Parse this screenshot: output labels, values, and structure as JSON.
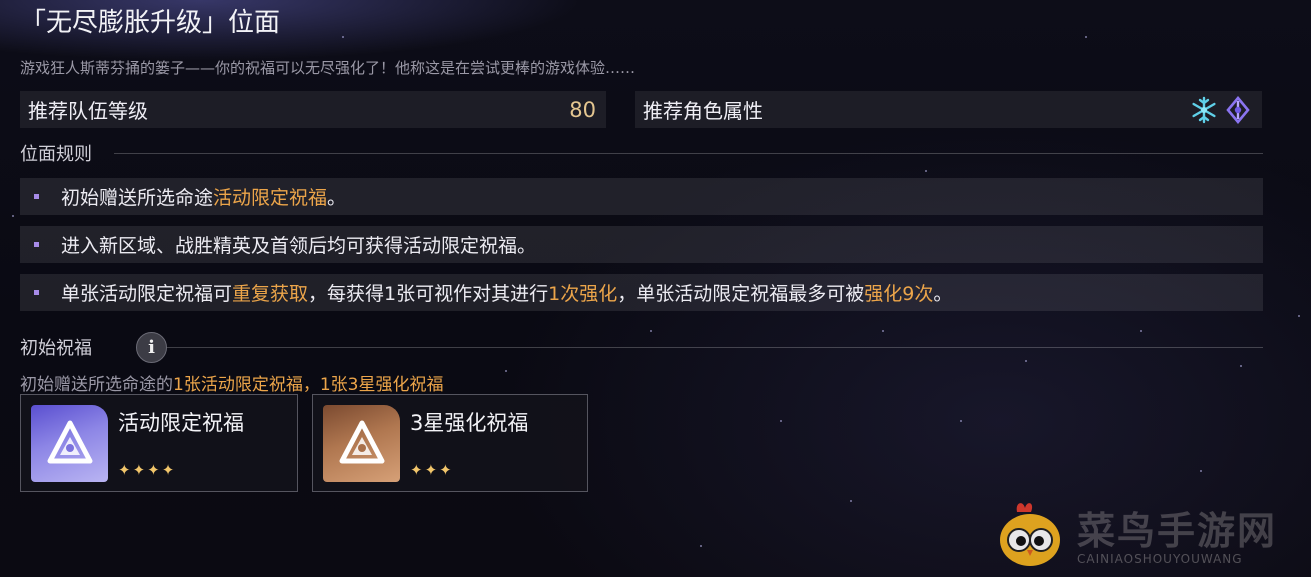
{
  "header": {
    "title": "「无尽膨胀升级」位面",
    "subtitle": "游戏狂人斯蒂芬捅的篓子——你的祝福可以无尽强化了！他称这是在尝试更棒的游戏体验……"
  },
  "stats": {
    "team_level_label": "推荐队伍等级",
    "team_level_value": "80",
    "char_attr_label": "推荐角色属性",
    "attr_icons": [
      "ice-snowflake-icon",
      "quantum-icon"
    ]
  },
  "rules_section": {
    "heading": "位面规则",
    "rules": [
      {
        "parts": [
          "初始赠送所选命途",
          "活动限定祝福",
          "。"
        ]
      },
      {
        "parts": [
          "进入新区域、战胜精英及首领后均可获得活动限定祝福。"
        ]
      },
      {
        "parts": [
          "单张活动限定祝福可",
          "重复获取",
          "，每获得1张可视作对其进行",
          "1次强化",
          "，单张活动限定祝福最多可被",
          "强化9次",
          "。"
        ]
      }
    ]
  },
  "blessing_section": {
    "heading": "初始祝福",
    "info_icon": "i",
    "desc_prefix": "初始赠送所选命途的",
    "desc_hl1": "1张活动限定祝福",
    "desc_sep": "，",
    "desc_hl2": "1张3星强化祝福",
    "cards": [
      {
        "title": "活动限定祝福",
        "stars": "✦✦✦✦",
        "tier": "purple"
      },
      {
        "title": "3星强化祝福",
        "stars": "✦✦✦",
        "tier": "bronze"
      }
    ]
  },
  "watermark": {
    "text": "菜鸟手游网",
    "sub": "CAINIAOSHOUYOUWANG"
  },
  "colors": {
    "highlight": "#eca54a",
    "value_gold": "#e4c690",
    "star_gold": "#f2c66b",
    "bullet_purple": "#a78be8"
  }
}
